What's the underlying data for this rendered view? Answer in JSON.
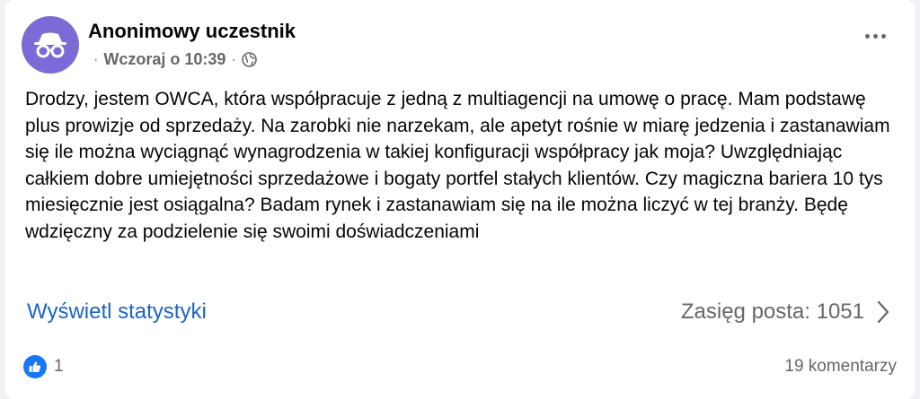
{
  "post": {
    "author": "Anonimowy uczestnik",
    "meta_separator": "·",
    "timestamp": "Wczoraj o 10:39",
    "meta_separator_2": "·",
    "privacy_icon": "globe-icon",
    "avatar_icon": "incognito-icon",
    "text": "Drodzy, jestem OWCA, która współpracuje z jedną z multiagencji na umowę o pracę. Mam podstawę plus prowizje od sprzedaży. Na zarobki nie narzekam, ale apetyt rośnie w miarę jedzenia i zastanawiam się ile można wyciągnąć wynagrodzenia w takiej konfiguracji współpracy jak moja? Uwzględniając całkiem dobre umiejętności sprzedażowe i bogaty portfel stałych klientów. Czy magiczna bariera 10 tys miesięcznie jest osiągalna? Badam rynek i zastanawiam się na ile można liczyć w tej branży. Będę wdzięczny za podzielenie się swoimi doświadczeniami"
  },
  "stats": {
    "link_label": "Wyświetl statystyki",
    "reach_label": "Zasięg posta: 1051"
  },
  "engagement": {
    "reaction_icon": "like-icon",
    "like_count": "1",
    "comments_label": "19 komentarzy"
  },
  "colors": {
    "avatar_bg": "#7b6bd6",
    "link": "#1b64c9",
    "like_badge": "#1877f2",
    "secondary_text": "#65676b"
  }
}
